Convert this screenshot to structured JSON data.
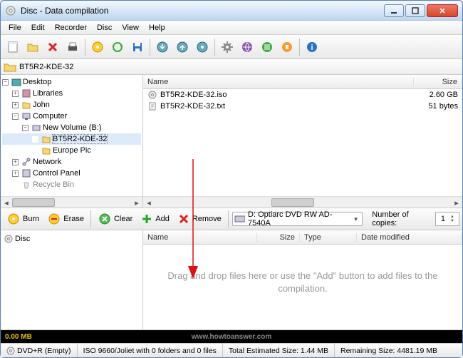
{
  "window": {
    "title": "Disc - Data compilation"
  },
  "menu": {
    "file": "File",
    "edit": "Edit",
    "recorder": "Recorder",
    "disc": "Disc",
    "view": "View",
    "help": "Help"
  },
  "crumb": {
    "path": "BT5R2-KDE-32"
  },
  "tree": {
    "desktop": "Desktop",
    "libraries": "Libraries",
    "john": "John",
    "computer": "Computer",
    "newvol": "New Volume (B:)",
    "bt5r2": "BT5R2-KDE-32",
    "europe": "Europe Pic",
    "network": "Network",
    "controlpanel": "Control Panel",
    "recycle": "Recycle Bin"
  },
  "filehead": {
    "name": "Name",
    "size": "Size"
  },
  "files": [
    {
      "name": "BT5R2-KDE-32.iso",
      "size": "2.60 GB"
    },
    {
      "name": "BT5R2-KDE-32.txt",
      "size": "51 bytes"
    }
  ],
  "mid": {
    "burn": "Burn",
    "erase": "Erase",
    "clear": "Clear",
    "add": "Add",
    "remove": "Remove",
    "device": "D: Optiarc DVD RW AD-7540A",
    "copies_label": "Number of copies:",
    "copies": "1"
  },
  "disc": {
    "root": "Disc"
  },
  "comphead": {
    "name": "Name",
    "size": "Size",
    "type": "Type",
    "date": "Date modified"
  },
  "dropmsg": "Drag and drop files here or use the \"Add\" button to add files to the compilation.",
  "progress": {
    "value": "0.00 MB",
    "watermark": "www.howtoanswer.com"
  },
  "status": {
    "media": "DVD+R (Empty)",
    "fs": "ISO 9660/Joliet with 0 folders and 0 files",
    "est": "Total Estimated Size: 1.44 MB",
    "remain": "Remaining Size: 4481.19 MB"
  }
}
